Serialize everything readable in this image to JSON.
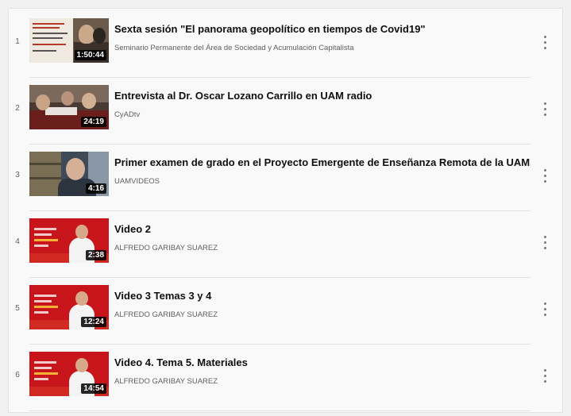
{
  "playlist": {
    "items": [
      {
        "index": "1",
        "title": "Sexta sesión \"El panorama geopolítico en tiempos de Covid19\"",
        "channel": "Seminario Permanente del Área de Sociedad y Acumulación Capitalista",
        "duration": "1:50:44",
        "thumb": "poster"
      },
      {
        "index": "2",
        "title": "Entrevista al Dr. Oscar Lozano Carrillo en UAM radio",
        "channel": "CyADtv",
        "duration": "24:19",
        "thumb": "group-photo"
      },
      {
        "index": "3",
        "title": "Primer examen de grado en el Proyecto Emergente de Enseñanza Remota de la UAM.",
        "channel": "UAMVIDEOS",
        "duration": "4:16",
        "thumb": "speaker-webcam"
      },
      {
        "index": "4",
        "title": "Video 2",
        "channel": "ALFREDO GARIBAY SUAREZ",
        "duration": "2:38",
        "thumb": "red-presenter"
      },
      {
        "index": "5",
        "title": "Video 3 Temas 3 y 4",
        "channel": "ALFREDO GARIBAY SUAREZ",
        "duration": "12:24",
        "thumb": "red-presenter"
      },
      {
        "index": "6",
        "title": "Video 4. Tema 5. Materiales",
        "channel": "ALFREDO GARIBAY SUAREZ",
        "duration": "14:54",
        "thumb": "red-presenter"
      }
    ],
    "menu_icon": "more-vert-icon",
    "colors": {
      "background": "#f9f9f9",
      "title": "#0f0f0f",
      "secondary": "#606060",
      "thumb_red": "#c8151b"
    }
  }
}
